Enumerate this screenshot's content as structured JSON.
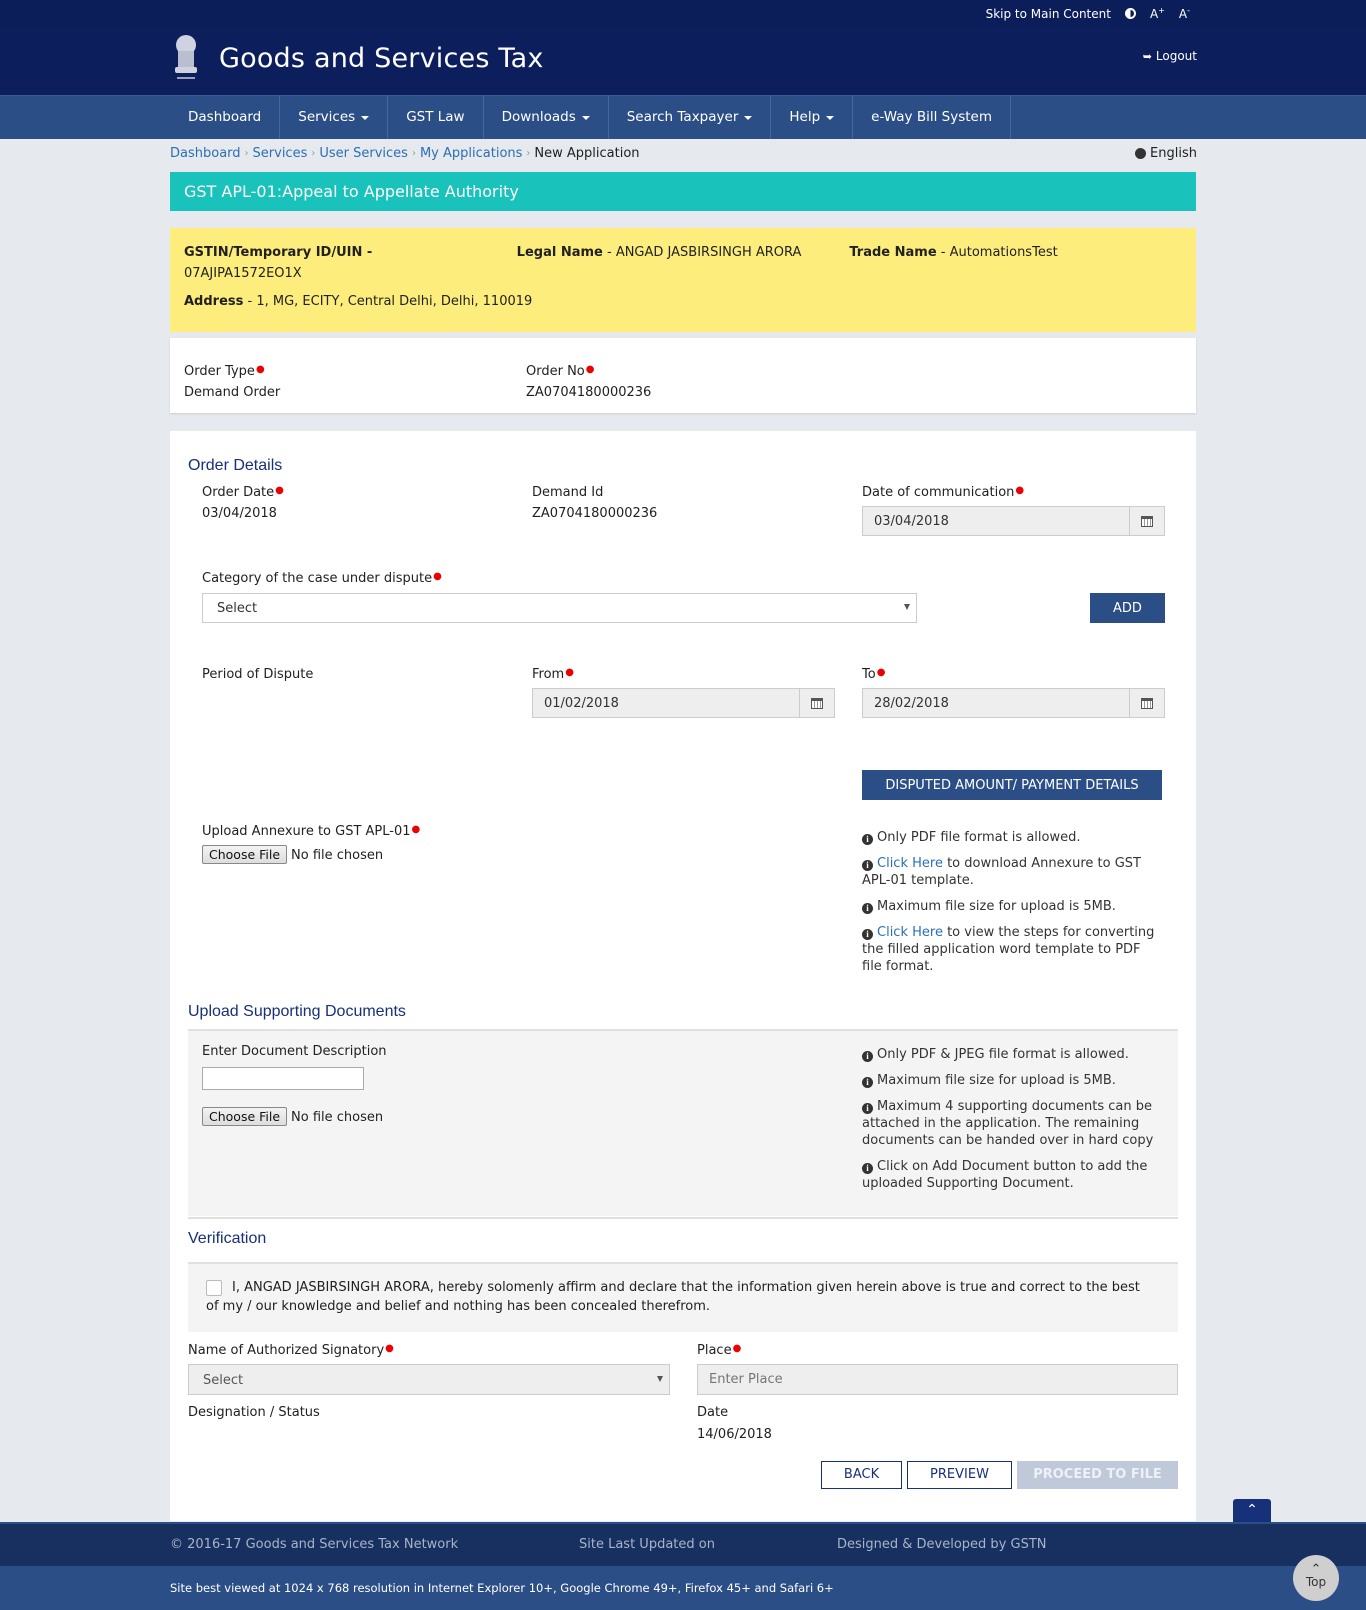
{
  "topbar": {
    "skip_link": "Skip to Main Content",
    "font_increase": "A+",
    "font_decrease": "A-"
  },
  "header": {
    "title": "Goods and Services Tax",
    "logout": "Logout"
  },
  "nav": {
    "items": [
      {
        "label": "Dashboard",
        "dropdown": false
      },
      {
        "label": "Services",
        "dropdown": true
      },
      {
        "label": "GST Law",
        "dropdown": false
      },
      {
        "label": "Downloads",
        "dropdown": true
      },
      {
        "label": "Search Taxpayer",
        "dropdown": true
      },
      {
        "label": "Help",
        "dropdown": true
      },
      {
        "label": "e-Way Bill System",
        "dropdown": false
      }
    ]
  },
  "breadcrumb": {
    "items": [
      "Dashboard",
      "Services",
      "User Services",
      "My Applications"
    ],
    "current": "New Application"
  },
  "language": "English",
  "page_title": "GST APL-01:Appeal to Appellate Authority",
  "taxpayer": {
    "gstin_label": "GSTIN/Temporary ID/UIN -",
    "gstin_value": "07AJIPA1572EO1X",
    "legal_name_label": "Legal Name",
    "legal_name_value": " - ANGAD JASBIRSINGH ARORA",
    "trade_name_label": "Trade Name",
    "trade_name_value": " - AutomationsTest",
    "address_label": "Address",
    "address_value": " - 1, MG, ECITY, Central Delhi, Delhi, 110019"
  },
  "order": {
    "type_label": "Order Type",
    "type_value": "Demand Order",
    "no_label": "Order No",
    "no_value": "ZA0704180000236"
  },
  "order_details": {
    "title": "Order Details",
    "order_date_label": "Order Date",
    "order_date_value": "03/04/2018",
    "demand_id_label": "Demand Id",
    "demand_id_value": "ZA0704180000236",
    "comm_date_label": "Date of communication",
    "comm_date_value": "03/04/2018",
    "category_label": "Category of the case under dispute",
    "category_value": "Select",
    "add_button": "ADD",
    "period_label": "Period of Dispute",
    "from_label": "From",
    "from_value": "01/02/2018",
    "to_label": "To",
    "to_value": "28/02/2018",
    "disputed_button": "DISPUTED AMOUNT/ PAYMENT DETAILS",
    "annexure_label": "Upload Annexure to GST APL-01",
    "choose_file": "Choose File",
    "no_file": "No file chosen",
    "annexure_info": [
      {
        "text": "Only PDF file format is allowed.",
        "link": ""
      },
      {
        "link": "Click Here",
        "text": " to download Annexure to GST APL-01 template."
      },
      {
        "text": "Maximum file size for upload is 5MB.",
        "link": ""
      },
      {
        "link": "Click Here",
        "text": " to view the steps for converting the filled application word template to PDF file format."
      }
    ]
  },
  "supporting_docs": {
    "title": "Upload Supporting Documents",
    "desc_label": "Enter Document Description",
    "desc_value": "",
    "choose_file": "Choose File",
    "no_file": "No file chosen",
    "info": [
      "Only PDF & JPEG file format is allowed.",
      "Maximum file size for upload is 5MB.",
      "Maximum 4 supporting documents can be attached in the application. The remaining documents can be handed over in hard copy",
      "Click on Add Document button to add the uploaded Supporting Document."
    ]
  },
  "verification": {
    "title": "Verification",
    "declaration": "I, ANGAD JASBIRSINGH ARORA, hereby solomenly affirm and declare that the information given herein above is true and correct to the best of my / our knowledge and belief and nothing has been concealed therefrom.",
    "checked": false,
    "signatory_label": "Name of Authorized Signatory",
    "signatory_value": "Select",
    "place_label": "Place",
    "place_placeholder": "Enter Place",
    "designation_label": "Designation / Status",
    "date_label": "Date",
    "date_value": "14/06/2018"
  },
  "actions": {
    "back": "BACK",
    "preview": "PREVIEW",
    "proceed": "PROCEED TO FILE"
  },
  "footer": {
    "copyright": "© 2016-17 Goods and Services Tax Network",
    "last_updated": "Site Last Updated on",
    "developed": "Designed & Developed by GSTN",
    "best_viewed": "Site best viewed at 1024 x 768 resolution in Internet Explorer 10+, Google Chrome 49+, Firefox 45+ and Safari 6+",
    "top_label": "Top"
  }
}
